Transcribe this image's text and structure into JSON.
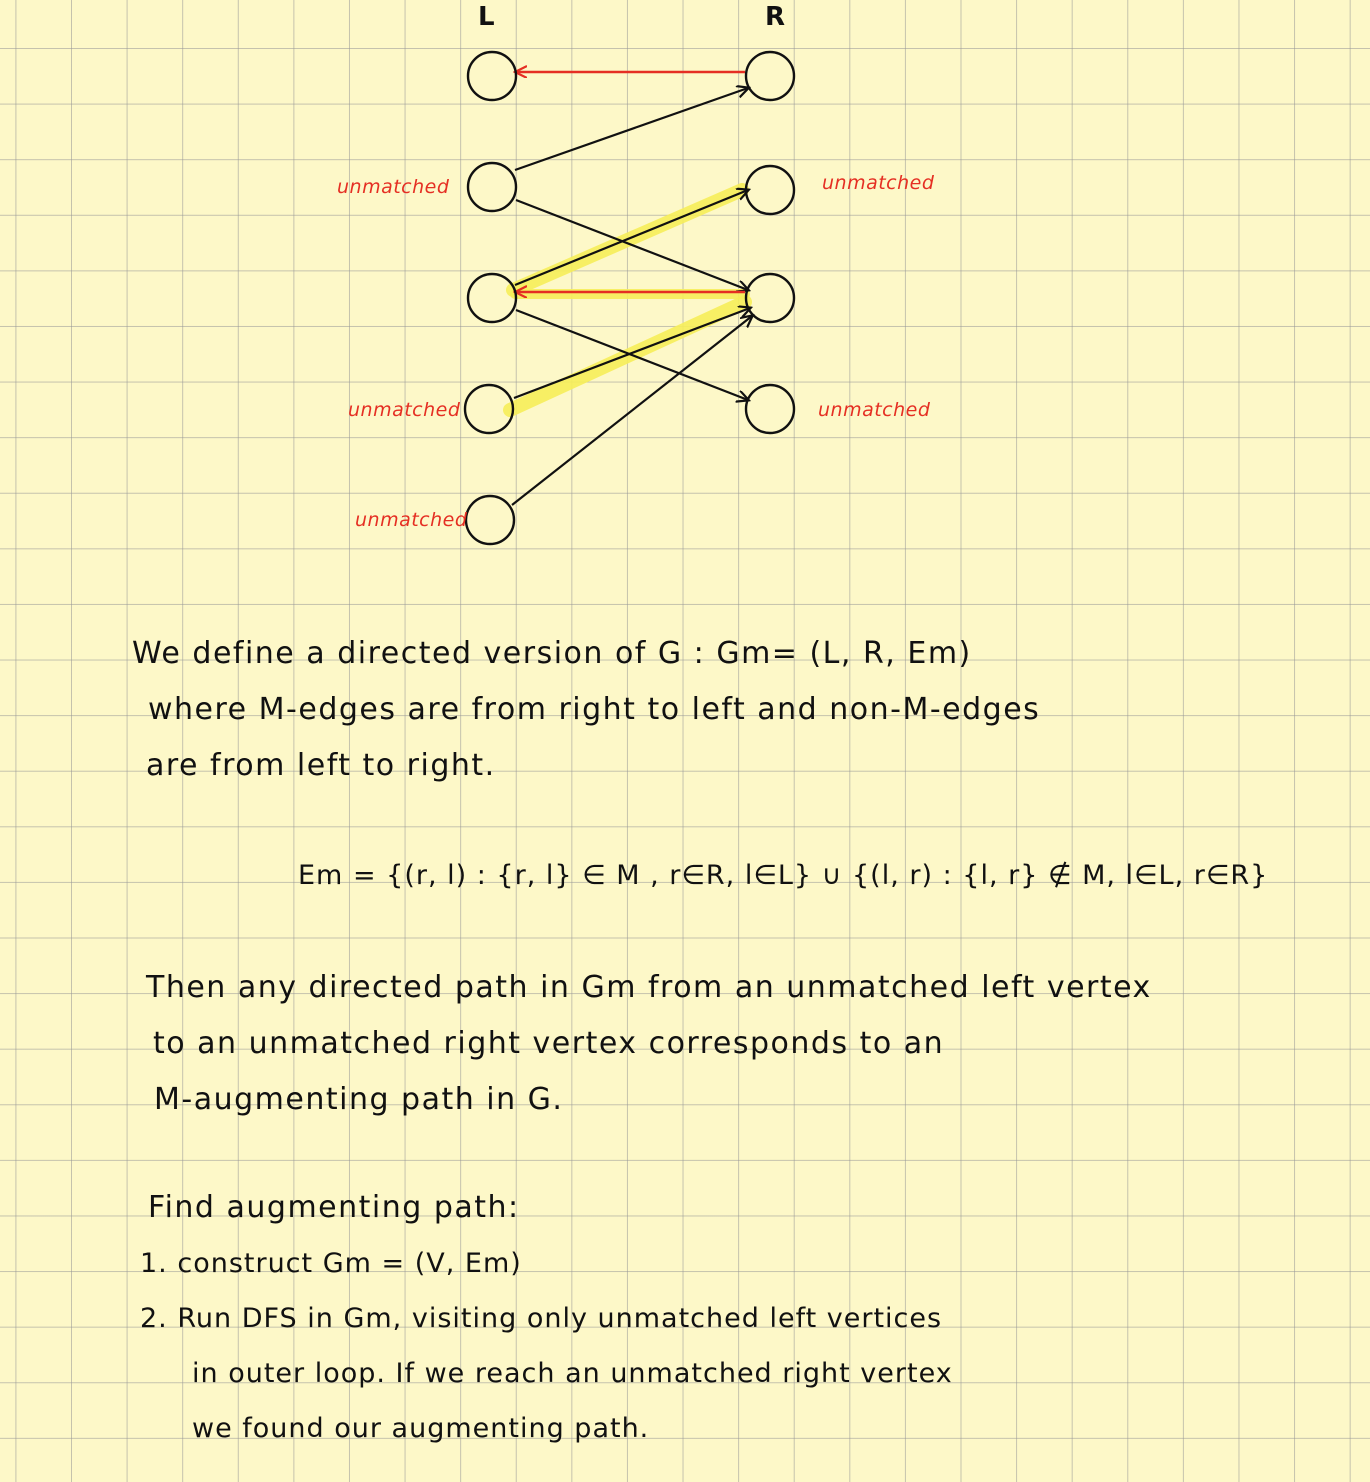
{
  "graph": {
    "left_label": "L",
    "right_label": "R",
    "left_unmatched": [
      "unmatched",
      "unmatched",
      "unmatched"
    ],
    "right_unmatched": [
      "unmatched",
      "unmatched"
    ],
    "colors": {
      "matched_edge": "#e52f23",
      "unmatched_edge": "#111111",
      "highlight": "#f7ef5a",
      "annotation": "#e52f23",
      "paper": "#fdf8c8",
      "grid": "#9a9a9a"
    }
  },
  "text": {
    "para1": [
      "We define a directed version of G : Gm= (L, R, Em)",
      "where M-edges are from right to left and non-M-edges",
      "are from left to right."
    ],
    "formula": "Em = {(r, l) : {r, l} ∈ M , r∈R, l∈L} ∪ {(l, r) : {l, r} ∉ M, l∈L, r∈R}",
    "para2": [
      "Then any directed path in Gm from an unmatched left vertex",
      "to an unmatched right vertex corresponds to an",
      "M-augmenting path in G."
    ],
    "steps_title": "Find augmenting path:",
    "steps": [
      "1. construct Gm = (V, Em)",
      "2. Run DFS in Gm, visiting only unmatched left vertices",
      "in outer loop. If we reach an unmatched right vertex",
      "we found our augmenting path."
    ]
  }
}
